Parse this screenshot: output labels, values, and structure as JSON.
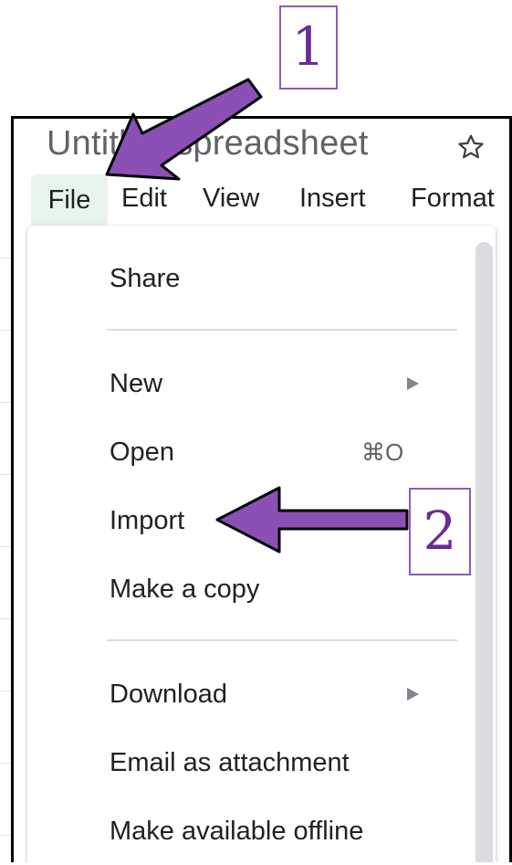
{
  "document": {
    "title": "Untitled spreadsheet"
  },
  "menubar": {
    "items": [
      "File",
      "Edit",
      "View",
      "Insert",
      "Format"
    ]
  },
  "file_menu": {
    "items": [
      {
        "label": "Share"
      },
      {
        "label": "New",
        "submenu": true
      },
      {
        "label": "Open",
        "shortcut": "⌘O"
      },
      {
        "label": "Import"
      },
      {
        "label": "Make a copy"
      },
      {
        "label": "Download",
        "submenu": true
      },
      {
        "label": "Email as attachment"
      },
      {
        "label": "Make available offline"
      }
    ]
  },
  "annotations": {
    "step_1": "1",
    "step_2": "2",
    "arrow_color": "#8b4fb5"
  },
  "icons": {
    "star": "star-outline-icon",
    "submenu": "triangle-right-icon"
  }
}
